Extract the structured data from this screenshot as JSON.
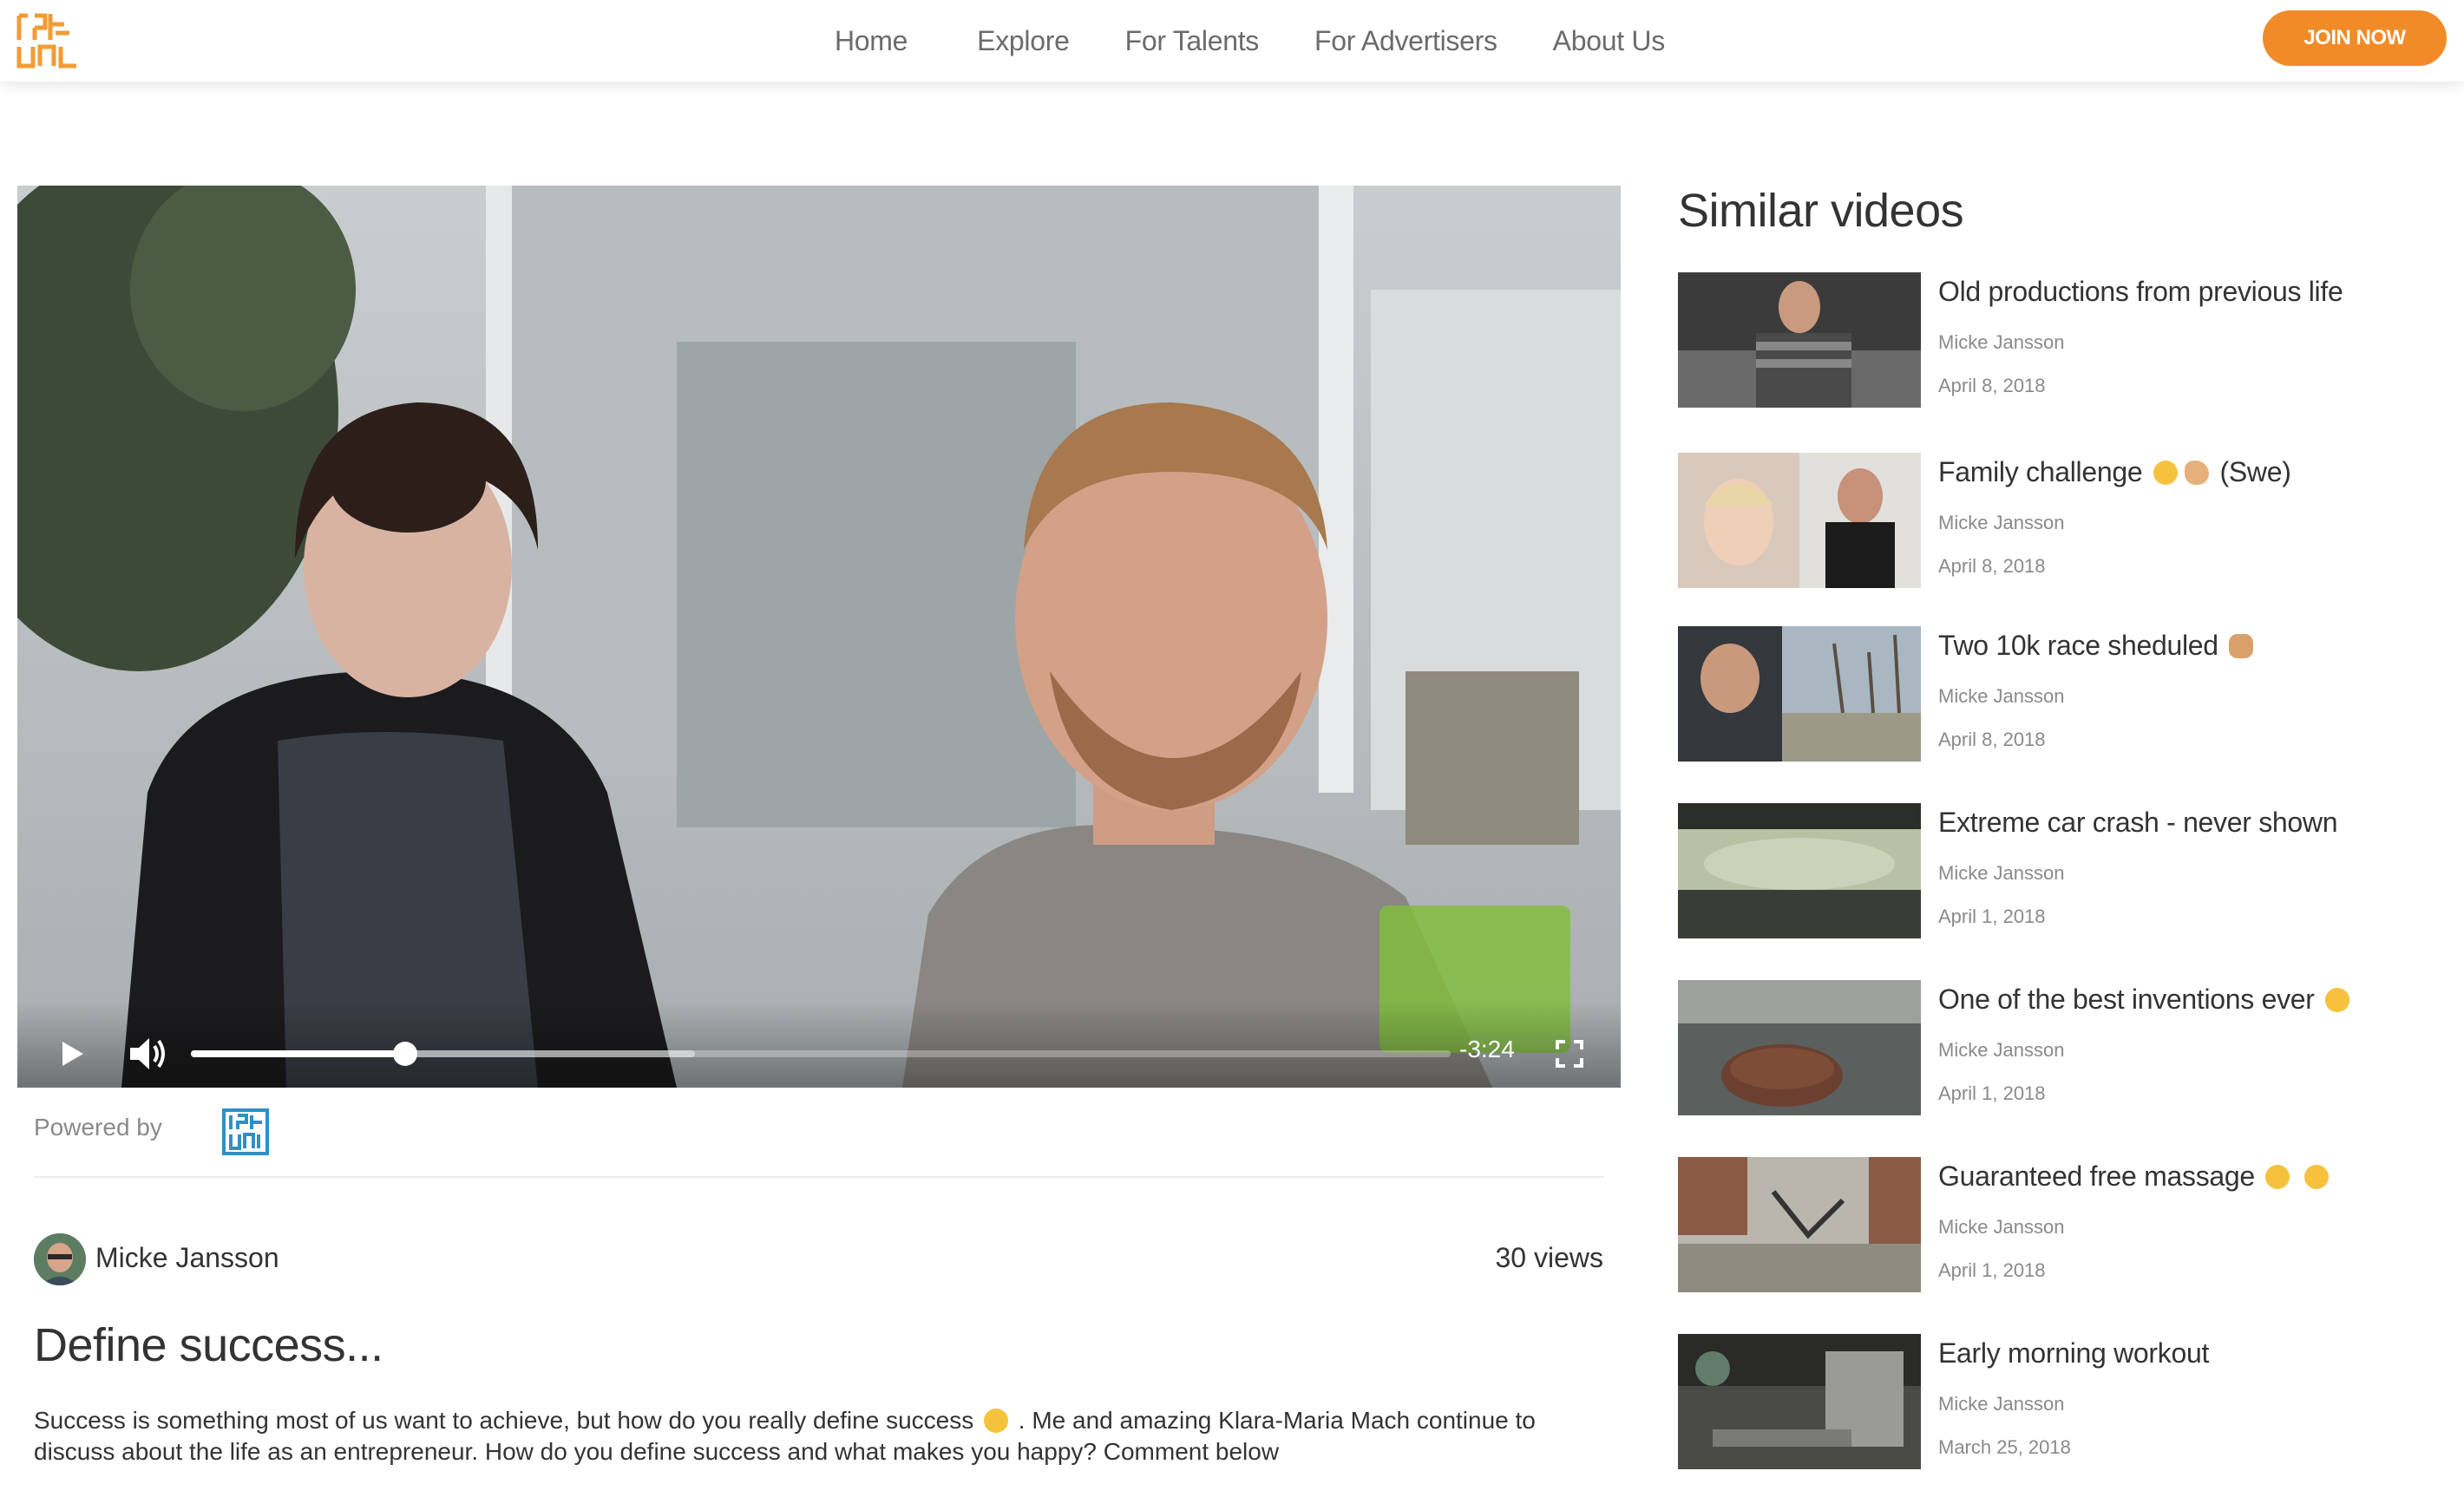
{
  "header": {
    "logo_icon": "brand-logo-icon",
    "nav": [
      {
        "label": "Home"
      },
      {
        "label": "Explore"
      },
      {
        "label": "For Talents"
      },
      {
        "label": "For Advertisers"
      },
      {
        "label": "About Us"
      }
    ],
    "join_label": "JOIN NOW",
    "accent_color": "#f18b27"
  },
  "player": {
    "time_remaining": "-3:24",
    "progress_fraction": 0.17,
    "buffered_fraction": 0.4,
    "icons": [
      "play-icon",
      "volume-icon",
      "fullscreen-icon"
    ]
  },
  "powered_by": {
    "label": "Powered by",
    "logo_icon": "brand-logo-blue-icon"
  },
  "video": {
    "author": "Micke Jansson",
    "views": "30 views",
    "title": "Define success...",
    "description_part1": "Success is something most of us want to achieve, but how do you really define success",
    "description_part2": ". Me and amazing Klara-Maria Mach continue to discuss about the life as an entrepreneur. How do you define success and what makes you happy? Comment below"
  },
  "sidebar": {
    "title": "Similar videos",
    "items": [
      {
        "title": "Old productions from previous life",
        "author": "Micke Jansson",
        "date": "April 8, 2018"
      },
      {
        "title": "Family challenge",
        "title_suffix": "(Swe)",
        "author": "Micke Jansson",
        "date": "April 8, 2018"
      },
      {
        "title": "Two 10k race sheduled",
        "author": "Micke Jansson",
        "date": "April 8, 2018"
      },
      {
        "title": "Extreme car crash - never shown",
        "author": "Micke Jansson",
        "date": "April 1, 2018"
      },
      {
        "title": "One of the best inventions ever",
        "author": "Micke Jansson",
        "date": "April 1, 2018"
      },
      {
        "title": "Guaranteed free massage",
        "author": "Micke Jansson",
        "date": "April 1, 2018"
      },
      {
        "title": "Early morning workout",
        "author": "Micke Jansson",
        "date": "March 25, 2018"
      }
    ]
  }
}
